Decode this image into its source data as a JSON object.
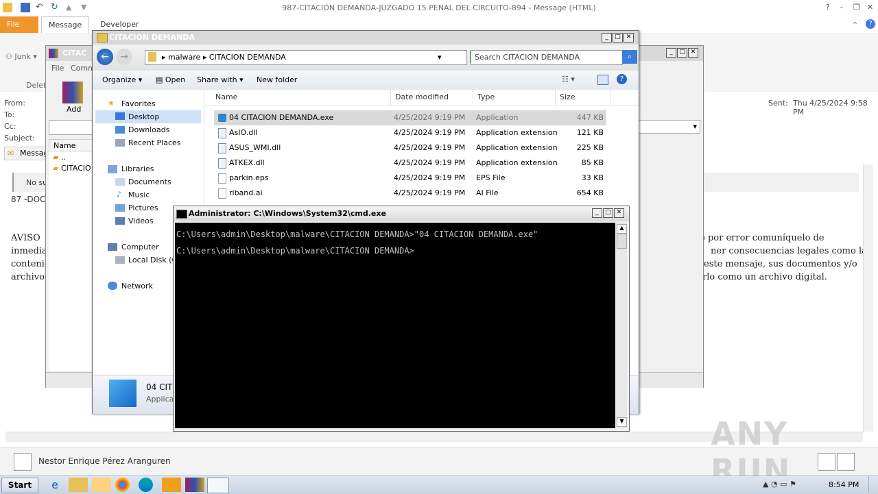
{
  "outlook": {
    "title": "987-CITACIÓN  DEMANDA-JUZGADO 15 PENAL DEL CIRCUITO-894 -  Message (HTML)",
    "tabs": {
      "file": "File",
      "message": "Message",
      "developer": "Developer"
    },
    "ribbon": {
      "junk": "Junk",
      "delete_partial": "Delet"
    },
    "header": {
      "from": "From:",
      "to": "To:",
      "cc": "Cc:",
      "subject": "Subject:",
      "sent_label": "Sent:",
      "sent_value": "Thu 4/25/2024 9:58 PM",
      "message_tab": "Message"
    },
    "body": {
      "no_subject_partial": "No su",
      "code_partial": "87 -DOC",
      "aviso_partial": "AVISO",
      "inmediat_partial": "inmediat",
      "conteni_partial": "contenid",
      "archivos_partial": "archivos",
      "right_line1": "ó por error comuníquelo de",
      "right_line2": "ner consecuencias legales como las",
      "right_line3": "este mensaje, sus documentos y/o",
      "right_line4": "rlo como un archivo digital."
    },
    "people": {
      "name": "Nestor Enrique Pérez Aranguren"
    }
  },
  "winrar": {
    "title_partial": "CITAC",
    "menu_file": "File",
    "menu_commands_partial": "Comm",
    "add_label": "Add",
    "col_name": "Name",
    "rows": [
      "..",
      "CITACIO"
    ]
  },
  "explorer": {
    "title": "CITACION DEMANDA",
    "breadcrumb": {
      "part1": "malware",
      "part2": "CITACION DEMANDA"
    },
    "search_placeholder": "Search CITACION DEMANDA",
    "toolbar": {
      "organize": "Organize",
      "open": "Open",
      "share_with": "Share with",
      "new_folder": "New folder"
    },
    "nav": {
      "favorites": "Favorites",
      "desktop": "Desktop",
      "downloads": "Downloads",
      "recent": "Recent Places",
      "libraries": "Libraries",
      "documents": "Documents",
      "music": "Music",
      "pictures": "Pictures",
      "videos": "Videos",
      "computer": "Computer",
      "local_disk": "Local Disk (C:",
      "network": "Network"
    },
    "columns": {
      "name": "Name",
      "date": "Date modified",
      "type": "Type",
      "size": "Size"
    },
    "files": [
      {
        "name": "04 CITACION DEMANDA.exe",
        "date": "4/25/2024 9:19 PM",
        "type": "Application",
        "size": "447 KB",
        "icon": "exe-icon"
      },
      {
        "name": "AsIO.dll",
        "date": "4/25/2024 9:19 PM",
        "type": "Application extension",
        "size": "121 KB",
        "icon": "dll-icon"
      },
      {
        "name": "ASUS_WMI.dll",
        "date": "4/25/2024 9:19 PM",
        "type": "Application extension",
        "size": "225 KB",
        "icon": "dll-icon"
      },
      {
        "name": "ATKEX.dll",
        "date": "4/25/2024 9:19 PM",
        "type": "Application extension",
        "size": "85 KB",
        "icon": "dll-icon"
      },
      {
        "name": "parkin.eps",
        "date": "4/25/2024 9:19 PM",
        "type": "EPS File",
        "size": "33 KB",
        "icon": "file-icon"
      },
      {
        "name": "riband.ai",
        "date": "4/25/2024 9:19 PM",
        "type": "AI File",
        "size": "654 KB",
        "icon": "file-icon"
      }
    ],
    "details": {
      "name_partial": "04 CIT",
      "type_partial": "Applicat"
    }
  },
  "cmd": {
    "title": "Administrator: C:\\Windows\\System32\\cmd.exe",
    "line1": "C:\\Users\\admin\\Desktop\\malware\\CITACION DEMANDA>\"04 CITACION DEMANDA.exe\"",
    "line2": "C:\\Users\\admin\\Desktop\\malware\\CITACION DEMANDA>"
  },
  "taskbar": {
    "start": "Start",
    "time": "8:54 PM"
  },
  "watermark": "ANY RUN"
}
